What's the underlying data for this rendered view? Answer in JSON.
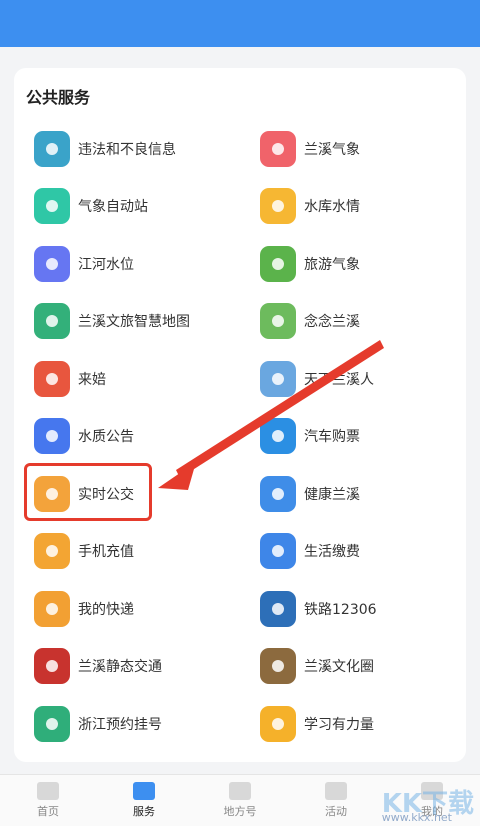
{
  "section_title": "公共服务",
  "services": [
    [
      {
        "label": "违法和不良信息",
        "icon": "diamond-icon",
        "color": "#3aa3c9"
      },
      {
        "label": "兰溪气象",
        "icon": "cloud-icon",
        "color": "#f0636a"
      }
    ],
    [
      {
        "label": "气象自动站",
        "icon": "weather-station-icon",
        "color": "#2fc7a6"
      },
      {
        "label": "水库水情",
        "icon": "pie-chart-icon",
        "color": "#f6b733"
      }
    ],
    [
      {
        "label": "江河水位",
        "icon": "river-icon",
        "color": "#6676f2"
      },
      {
        "label": "旅游气象",
        "icon": "tourism-icon",
        "color": "#5bb34b"
      }
    ],
    [
      {
        "label": "兰溪文旅智慧地图",
        "icon": "map-pin-icon",
        "color": "#33b07a"
      },
      {
        "label": "念念兰溪",
        "icon": "leaf-icon",
        "color": "#6dbb5d"
      }
    ],
    [
      {
        "label": "来婄",
        "icon": "teapot-icon",
        "color": "#e8563e"
      },
      {
        "label": "天下兰溪人",
        "icon": "mountain-icon",
        "color": "#6aa7e0"
      }
    ],
    [
      {
        "label": "水质公告",
        "icon": "document-icon",
        "color": "#4677ee"
      },
      {
        "label": "汽车购票",
        "icon": "bus-icon",
        "color": "#2b8fe3"
      }
    ],
    [
      {
        "label": "实时公交",
        "icon": "bus-search-icon",
        "color": "#f3a33b"
      },
      {
        "label": "健康兰溪",
        "icon": "health-icon",
        "color": "#3f8de8"
      }
    ],
    [
      {
        "label": "手机充值",
        "icon": "phone-icon",
        "color": "#f3a533"
      },
      {
        "label": "生活缴费",
        "icon": "lightning-icon",
        "color": "#3e86e8"
      }
    ],
    [
      {
        "label": "我的快递",
        "icon": "delivery-icon",
        "color": "#f2a033"
      },
      {
        "label": "铁路12306",
        "icon": "railway-icon",
        "color": "#2d6fb8"
      }
    ],
    [
      {
        "label": "兰溪静态交通",
        "icon": "traffic-logo-icon",
        "color": "#c8332e"
      },
      {
        "label": "兰溪文化圈",
        "icon": "culture-photo-icon",
        "color": "#8c6a3e"
      }
    ],
    [
      {
        "label": "浙江预约挂号",
        "icon": "hospital-icon",
        "color": "#2fae7a"
      },
      {
        "label": "学习有力量",
        "icon": "study-icon",
        "color": "#f5b12a"
      }
    ]
  ],
  "tabs": [
    {
      "label": "首页",
      "icon": "home-icon"
    },
    {
      "label": "服务",
      "icon": "heart-icon"
    },
    {
      "label": "地方号",
      "icon": "local-icon"
    },
    {
      "label": "活动",
      "icon": "activity-icon"
    },
    {
      "label": "我的",
      "icon": "user-icon"
    }
  ],
  "watermark": {
    "main": "KK下载",
    "sub": "www.kkx.net"
  }
}
